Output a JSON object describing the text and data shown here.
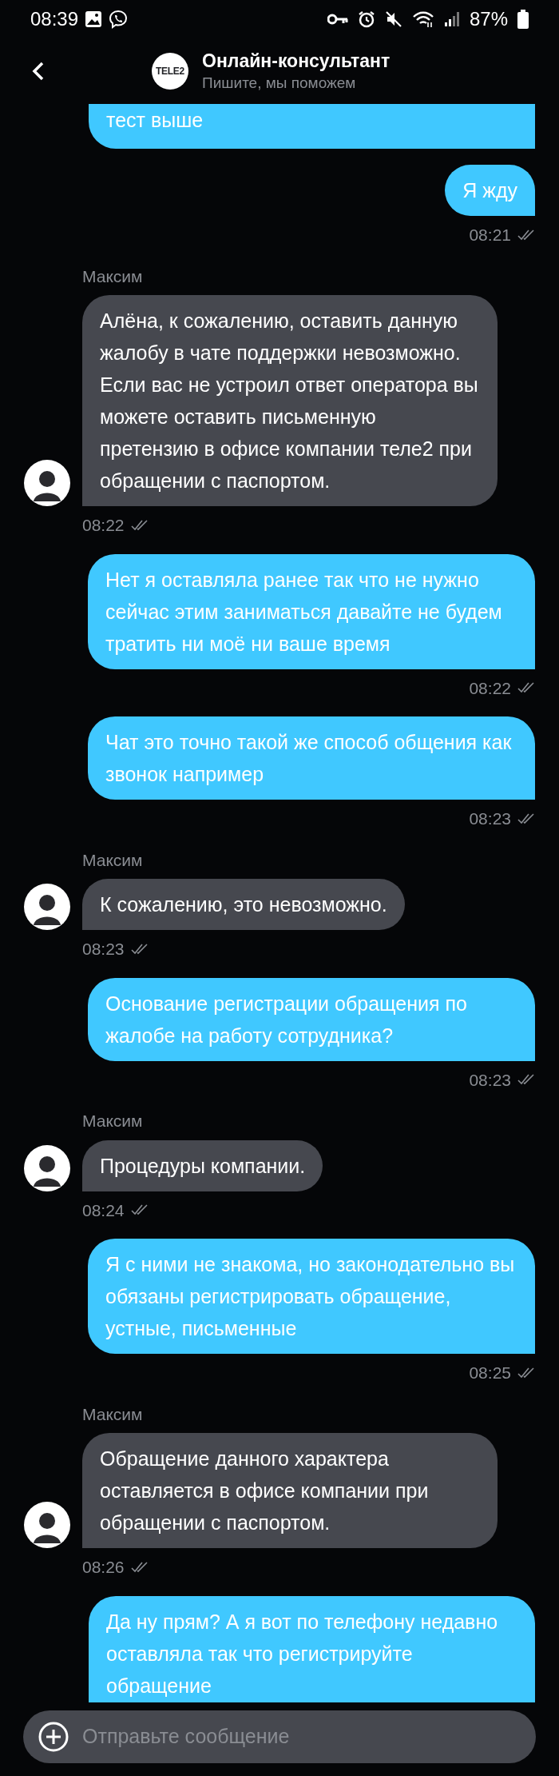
{
  "status_bar": {
    "time": "08:39",
    "battery": "87%"
  },
  "header": {
    "logo": "TELE2",
    "title": "Онлайн-консультант",
    "subtitle": "Пишите, мы поможем"
  },
  "messages": [
    {
      "kind": "outgoing",
      "text": "тест выше",
      "cut": true
    },
    {
      "kind": "outgoing",
      "text": "Я жду",
      "time": "08:21"
    },
    {
      "kind": "incoming",
      "sender": "Максим",
      "text": "Алёна, к сожалению, оставить данную жалобу в чате поддержки невозможно. Если вас не устроил ответ оператора вы можете оставить письменную претензию в офисе компании теле2 при обращении с паспортом.",
      "time": "08:22"
    },
    {
      "kind": "outgoing",
      "text": "Нет я оставляла ранее так что не нужно сейчас этим заниматься давайте не будем тратить ни моё ни ваше время",
      "time": "08:22"
    },
    {
      "kind": "outgoing",
      "text": "Чат это точно такой же способ общения как звонок например",
      "time": "08:23"
    },
    {
      "kind": "incoming",
      "sender": "Максим",
      "text": "К сожалению, это невозможно.",
      "time": "08:23"
    },
    {
      "kind": "outgoing",
      "text": "Основание регистрации обращения по жалобе на работу сотрудника?",
      "time": "08:23"
    },
    {
      "kind": "incoming",
      "sender": "Максим",
      "text": "Процедуры компании.",
      "time": "08:24"
    },
    {
      "kind": "outgoing",
      "text": "Я с ними не знакома, но законодательно вы обязаны регистрировать обращение, устные, письменные",
      "time": "08:25"
    },
    {
      "kind": "incoming",
      "sender": "Максим",
      "text": "Обращение данного характера оставляется в офисе компании при обращении с паспортом.",
      "time": "08:26"
    },
    {
      "kind": "outgoing",
      "text": "Да ну прям? А я вот по телефону недавно оставляла так что регистрируйте обращение"
    }
  ],
  "composer": {
    "placeholder": "Отправьте сообщение"
  }
}
